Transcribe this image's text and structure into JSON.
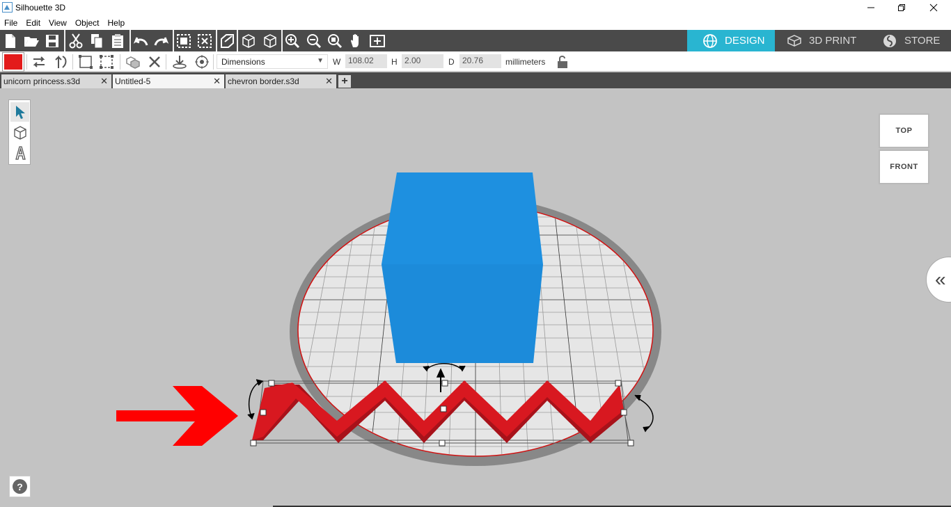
{
  "window": {
    "title": "Silhouette 3D"
  },
  "menu": {
    "items": [
      "File",
      "Edit",
      "View",
      "Object",
      "Help"
    ]
  },
  "toolbar": {
    "icons": [
      "new-document-icon",
      "open-folder-icon",
      "save-icon",
      "cut-icon",
      "copy-icon",
      "paste-icon",
      "undo-icon",
      "redo-icon",
      "group-icon",
      "ungroup-icon",
      "extrude-icon",
      "cube-outline-icon",
      "cube-solid-icon",
      "zoom-in-icon",
      "zoom-out-icon",
      "zoom-fit-icon",
      "pan-hand-icon",
      "zoom-extents-icon"
    ]
  },
  "modes": {
    "design": "DESIGN",
    "print": "3D PRINT",
    "store": "STORE"
  },
  "properties": {
    "color": "#e31b1b",
    "mode_select": "Dimensions",
    "w_label": "W",
    "w_value": "108.02",
    "h_label": "H",
    "h_value": "2.00",
    "d_label": "D",
    "d_value": "20.76",
    "units": "millimeters"
  },
  "tabs": [
    {
      "label": "unicorn princess.s3d",
      "active": false
    },
    {
      "label": "Untitled-5",
      "active": true
    },
    {
      "label": "chevron border.s3d",
      "active": false
    }
  ],
  "viewcube": {
    "top": "TOP",
    "front": "FRONT"
  },
  "colors": {
    "accent": "#29b5d1",
    "cube": "#1e90e0",
    "chevron": "#d81820",
    "arrow": "#ff0000"
  }
}
